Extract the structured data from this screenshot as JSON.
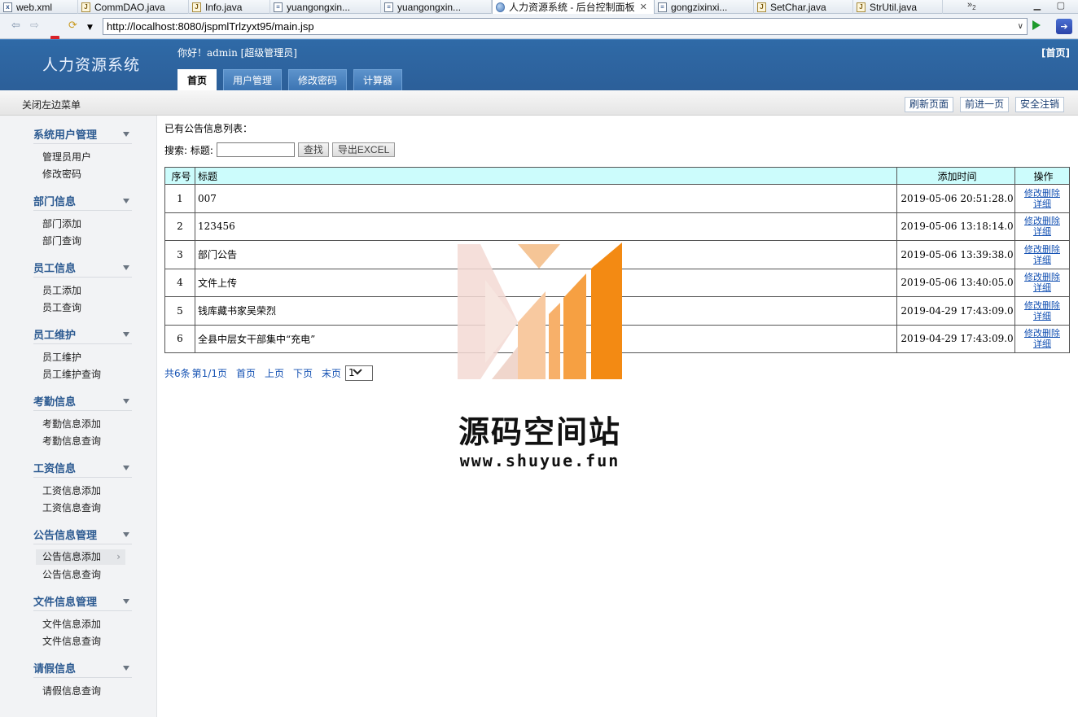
{
  "editor_tabs": [
    {
      "icon": "xml-file-icon",
      "label": "web.xml",
      "kind": "x"
    },
    {
      "icon": "java-file-icon",
      "label": "CommDAO.java",
      "kind": "j"
    },
    {
      "icon": "java-file-icon",
      "label": "Info.java",
      "kind": "j"
    },
    {
      "icon": "jsp-file-icon",
      "label": "yuangongxin...",
      "kind": "d"
    },
    {
      "icon": "jsp-file-icon",
      "label": "yuangongxin...",
      "kind": "d"
    },
    {
      "icon": "browser-globe-icon",
      "label": "人力资源系统 - 后台控制面板",
      "kind": "globe",
      "active": true
    },
    {
      "icon": "jsp-file-icon",
      "label": "gongzixinxi...",
      "kind": "d"
    },
    {
      "icon": "java-file-icon",
      "label": "SetChar.java",
      "kind": "j"
    },
    {
      "icon": "java-file-icon",
      "label": "StrUtil.java",
      "kind": "j"
    }
  ],
  "tab_overflow": "»",
  "tab_overflow_count": "2",
  "tab_close_glyph": "✕",
  "browser": {
    "url": "http://localhost:8080/jspmlTrlzyxt95/main.jsp"
  },
  "header": {
    "system_title": "人力资源系统",
    "greeting_prefix": "你好！",
    "user": "admin",
    "role": "[超级管理员]",
    "home_link": "[首页]",
    "menu_tabs": [
      {
        "label": "首页",
        "active": true
      },
      {
        "label": "用户管理"
      },
      {
        "label": "修改密码"
      },
      {
        "label": "计算器"
      }
    ]
  },
  "toolbar": {
    "close_menu": "关闭左边菜单",
    "refresh": "刷新页面",
    "forward": "前进一页",
    "logout": "安全注销"
  },
  "sidebar": {
    "groups": [
      {
        "title": "系统用户管理",
        "items": [
          "管理员用户",
          "修改密码"
        ]
      },
      {
        "title": "部门信息",
        "items": [
          "部门添加",
          "部门查询"
        ]
      },
      {
        "title": "员工信息",
        "items": [
          "员工添加",
          "员工查询"
        ]
      },
      {
        "title": "员工维护",
        "items": [
          "员工维护",
          "员工维护查询"
        ]
      },
      {
        "title": "考勤信息",
        "items": [
          "考勤信息添加",
          "考勤信息查询"
        ]
      },
      {
        "title": "工资信息",
        "items": [
          "工资信息添加",
          "工资信息查询"
        ]
      },
      {
        "title": "公告信息管理",
        "items": [
          "公告信息添加",
          "公告信息查询"
        ],
        "selected_item": 0
      },
      {
        "title": "文件信息管理",
        "items": [
          "文件信息添加",
          "文件信息查询"
        ]
      },
      {
        "title": "请假信息",
        "items": [
          "请假信息查询"
        ]
      }
    ]
  },
  "main": {
    "list_title": "已有公告信息列表：",
    "search": {
      "label": "搜索: 标题:",
      "value": "",
      "search_button": "查找",
      "export_button": "导出EXCEL"
    },
    "table": {
      "headers": [
        "序号",
        "标题",
        "添加时间",
        "操作"
      ],
      "rows": [
        {
          "no": "1",
          "title": "007",
          "time": "2019-05-06 20:51:28.0"
        },
        {
          "no": "2",
          "title": "123456",
          "time": "2019-05-06 13:18:14.0"
        },
        {
          "no": "3",
          "title": "部门公告",
          "time": "2019-05-06 13:39:38.0"
        },
        {
          "no": "4",
          "title": "文件上传",
          "time": "2019-05-06 13:40:05.0"
        },
        {
          "no": "5",
          "title": "钱库藏书家吴荣烈",
          "time": "2019-04-29 17:43:09.0"
        },
        {
          "no": "6",
          "title": "全县中层女干部集中“充电”",
          "time": "2019-04-29 17:43:09.0"
        }
      ],
      "op_edit": "修改",
      "op_delete": "删除",
      "op_detail": "详细"
    },
    "pager": {
      "total": "共6条",
      "page": "第1/1页",
      "first": "首页",
      "prev": "上页",
      "next": "下页",
      "last": "末页",
      "select_value": "1"
    }
  },
  "watermark": {
    "text": "源码空间站",
    "url": "www.shuyue.fun"
  }
}
